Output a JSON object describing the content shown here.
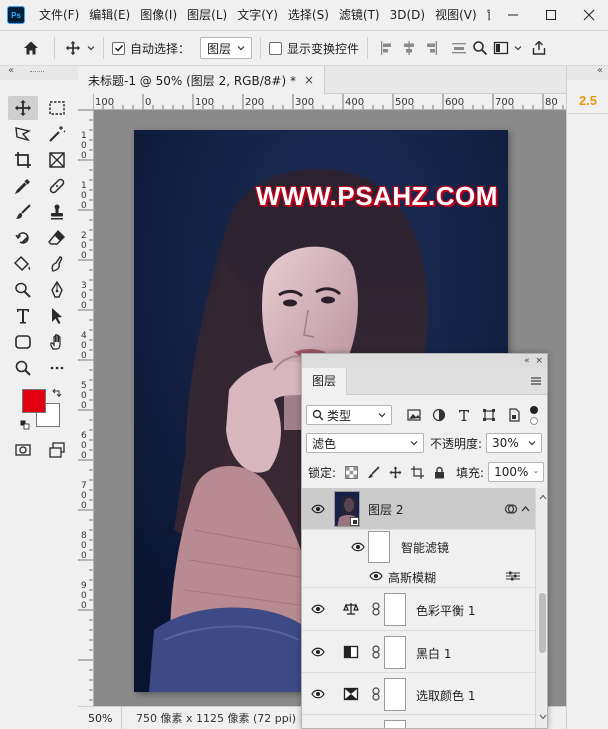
{
  "app": {
    "logo_text": "Ps"
  },
  "menu": [
    "文件(F)",
    "编辑(E)",
    "图像(I)",
    "图层(L)",
    "文字(Y)",
    "选择(S)",
    "滤镜(T)",
    "3D(D)",
    "视图(V)",
    "窗"
  ],
  "options_bar": {
    "auto_select_label": "自动选择：",
    "auto_select_checked": true,
    "auto_select_target": "图层",
    "show_transform_label": "显示变换控件",
    "show_transform_checked": false
  },
  "document": {
    "tab_title": "未标题-1 @ 50% (图层 2, RGB/8#) *",
    "close_glyph": "×",
    "watermark": "WWW.PSAHZ.COM",
    "ruler_h_labels": [
      "100",
      "0",
      "100",
      "200",
      "300",
      "400",
      "500",
      "600",
      "700",
      "80"
    ],
    "ruler_v_labels": [
      "1",
      "0",
      "0",
      "1",
      "0",
      "0",
      "2",
      "0",
      "0",
      "3",
      "0",
      "0",
      "4",
      "0",
      "0",
      "5",
      "0",
      "0",
      "6",
      "0",
      "0",
      "7",
      "0",
      "0",
      "8",
      "0",
      "0",
      "9",
      "0",
      "0"
    ]
  },
  "status_bar": {
    "zoom": "50%",
    "doc_info": "750 像素 x 1125 像素 (72 ppi)"
  },
  "colors": {
    "foreground": "#e00010",
    "background": "#ffffff",
    "version_accent": "#e69a12"
  },
  "version_badge": "2.5",
  "layers_panel": {
    "collapse_glyph": "«",
    "close_glyph": "×",
    "tab": "图层",
    "filter_kind": "类型",
    "blend_mode": "滤色",
    "opacity_label": "不透明度:",
    "opacity_value": "30%",
    "lock_label": "锁定:",
    "fill_label": "填充:",
    "fill_value": "100%",
    "layers": [
      {
        "name": "图层 2",
        "type": "smart-object",
        "selected": true,
        "visible": true
      },
      {
        "name": "智能滤镜",
        "type": "smart-filter-group",
        "visible": true
      },
      {
        "name": "高斯模糊",
        "type": "filter",
        "visible": true
      },
      {
        "name": "色彩平衡 1",
        "type": "color-balance-adjustment",
        "visible": true
      },
      {
        "name": "黑白 1",
        "type": "black-white-adjustment",
        "visible": true
      },
      {
        "name": "选取颜色 1",
        "type": "selective-color-adjustment",
        "visible": true
      }
    ]
  }
}
